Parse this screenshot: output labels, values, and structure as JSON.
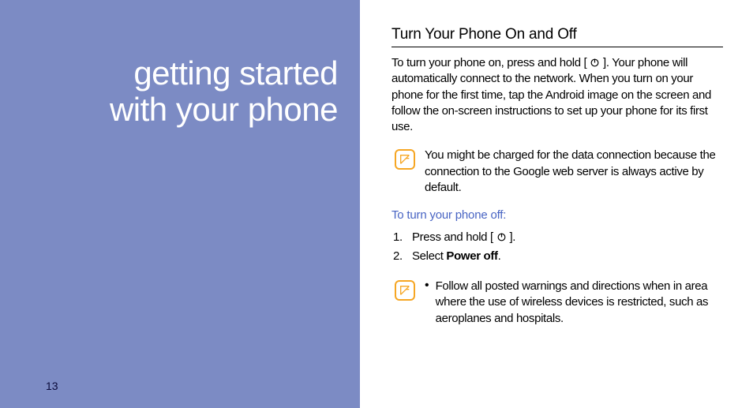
{
  "left": {
    "title_line1": "getting started",
    "title_line2": "with your phone",
    "page_number": "13"
  },
  "right": {
    "section_title": "Turn Your Phone On and Off",
    "intro_prefix": "To turn your phone on, press and hold [",
    "intro_suffix": "]. Your phone will automatically connect to the network. When you turn on your phone for the first time, tap the Android image on the screen and follow the on-screen instructions to set up your phone for its first use.",
    "note1": "You might be charged for the data connection because the connection to the Google web server is always active by default.",
    "subhead": "To turn your phone off:",
    "steps": [
      {
        "prefix": "Press and hold [",
        "suffix": "].",
        "has_icon": true
      },
      {
        "prefix": "Select ",
        "bold": "Power off",
        "suffix": "."
      }
    ],
    "note2_bullet": "Follow all posted warnings and directions when in area where the use of wireless devices is restricted, such as aeroplanes and hospitals."
  }
}
